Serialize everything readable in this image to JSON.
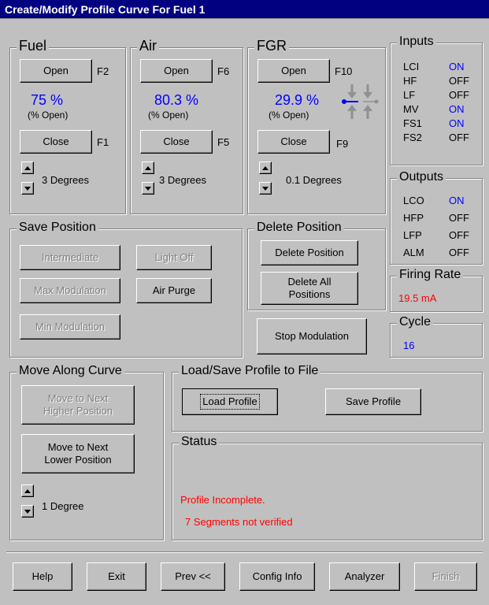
{
  "window": {
    "title": "Create/Modify Profile Curve For Fuel 1"
  },
  "fuel": {
    "label": "Fuel",
    "open_label": "Open",
    "open_key": "F2",
    "percent": "75 %",
    "percent_caption": "(% Open)",
    "close_label": "Close",
    "close_key": "F1",
    "step": "3 Degrees"
  },
  "air": {
    "label": "Air",
    "open_label": "Open",
    "open_key": "F6",
    "percent": "80.3 %",
    "percent_caption": "(% Open)",
    "close_label": "Close",
    "close_key": "F5",
    "step": "3 Degrees"
  },
  "fgr": {
    "label": "FGR",
    "open_label": "Open",
    "open_key": "F10",
    "percent": "29.9 %",
    "percent_caption": "(% Open)",
    "close_label": "Close",
    "close_key": "F9",
    "step": "0.1 Degrees"
  },
  "inputs": {
    "label": "Inputs",
    "items": [
      {
        "name": "LCI",
        "value": "ON"
      },
      {
        "name": "HF",
        "value": "OFF"
      },
      {
        "name": "LF",
        "value": "OFF"
      },
      {
        "name": "MV",
        "value": "ON"
      },
      {
        "name": "FS1",
        "value": "ON"
      },
      {
        "name": "FS2",
        "value": "OFF"
      }
    ]
  },
  "outputs": {
    "label": "Outputs",
    "items": [
      {
        "name": "LCO",
        "value": "ON"
      },
      {
        "name": "HFP",
        "value": "OFF"
      },
      {
        "name": "LFP",
        "value": "OFF"
      },
      {
        "name": "ALM",
        "value": "OFF"
      }
    ]
  },
  "firing_rate": {
    "label": "Firing Rate",
    "value": "19.5 mA"
  },
  "cycle": {
    "label": "Cycle",
    "value": "16"
  },
  "save_position": {
    "label": "Save Position",
    "intermediate": "Intermediate",
    "light_off": "Light Off",
    "max_modulation": "Max Modulation",
    "air_purge": "Air Purge",
    "min_modulation": "Min Modulation"
  },
  "delete_position": {
    "label": "Delete Position",
    "delete": "Delete Position",
    "delete_all": "Delete All\nPositions"
  },
  "stop_modulation": "Stop Modulation",
  "move_along_curve": {
    "label": "Move Along Curve",
    "next_higher": "Move to Next\nHigher Position",
    "next_lower": "Move to Next\nLower Position",
    "step": "1 Degree"
  },
  "load_save": {
    "label": "Load/Save Profile to File",
    "load": "Load Profile",
    "save": "Save Profile"
  },
  "status": {
    "label": "Status",
    "line1": "Profile Incomplete.",
    "line2": "7 Segments not verified"
  },
  "footer": {
    "help": "Help",
    "exit": "Exit",
    "prev": "Prev <<",
    "config": "Config Info",
    "analyzer": "Analyzer",
    "finish": "Finish"
  },
  "colors": {
    "on": "#0000ff",
    "off": "#000000",
    "alert": "#ff0000",
    "title_bar": "#000080"
  }
}
